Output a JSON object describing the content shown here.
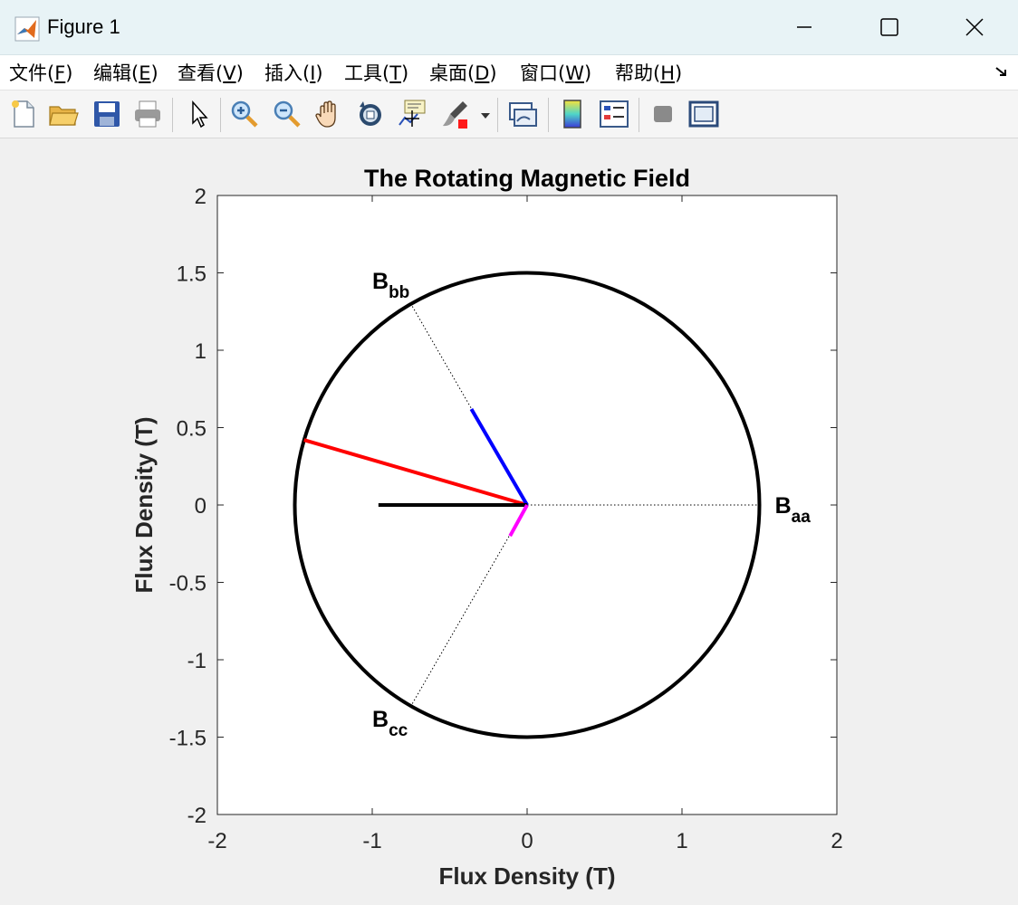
{
  "window": {
    "title": "Figure 1"
  },
  "menu": [
    {
      "label": "文件(",
      "key": "F",
      "tail": ")"
    },
    {
      "label": "编辑(",
      "key": "E",
      "tail": ")"
    },
    {
      "label": "查看(",
      "key": "V",
      "tail": ")"
    },
    {
      "label": "插入(",
      "key": "I",
      "tail": ")"
    },
    {
      "label": "工具(",
      "key": "T",
      "tail": ")"
    },
    {
      "label": "桌面(",
      "key": "D",
      "tail": ")"
    },
    {
      "label": "窗口(",
      "key": "W",
      "tail": ")"
    },
    {
      "label": "帮助(",
      "key": "H",
      "tail": ")"
    }
  ],
  "toolbar_icons": [
    "new-file-icon",
    "open-folder-icon",
    "save-icon",
    "print-icon",
    "pointer-icon",
    "zoom-in-icon",
    "zoom-out-icon",
    "pan-hand-icon",
    "rotate-3d-icon",
    "data-cursor-icon",
    "brush-icon",
    "brush-dropdown-icon",
    "link-plot-icon",
    "colorbar-icon",
    "legend-icon",
    "hide-plot-tools-icon",
    "show-plot-tools-icon"
  ],
  "chart_data": {
    "type": "line",
    "title": "The Rotating Magnetic Field",
    "xlabel": "Flux Density (T)",
    "ylabel": "Flux Density (T)",
    "xlim": [
      -2,
      2
    ],
    "ylim": [
      -2,
      2
    ],
    "xticks": [
      -2,
      -1,
      0,
      1,
      2
    ],
    "yticks": [
      -2,
      -1.5,
      -1,
      -0.5,
      0,
      0.5,
      1,
      1.5,
      2
    ],
    "xtick_labels": [
      "-2",
      "-1",
      "0",
      "1",
      "2"
    ],
    "ytick_labels": [
      "2",
      "1.5",
      "1",
      "0.5",
      "0",
      "-0.5",
      "-1",
      "-1.5",
      "-2"
    ],
    "grid": false,
    "circle": {
      "radius": 1.5,
      "color": "#000000"
    },
    "axis_lines": [
      {
        "name": "aa-axis",
        "x": [
          0,
          1.5
        ],
        "y": [
          0,
          0
        ]
      },
      {
        "name": "bb-axis",
        "x": [
          0,
          -0.75
        ],
        "y": [
          0,
          1.299
        ]
      },
      {
        "name": "cc-axis",
        "x": [
          0,
          -0.75
        ],
        "y": [
          0,
          -1.299
        ]
      }
    ],
    "vectors": [
      {
        "name": "red-vector",
        "color": "#ff0000",
        "x": [
          0,
          -1.44
        ],
        "y": [
          0,
          0.42
        ]
      },
      {
        "name": "blue-vector",
        "color": "#0000ff",
        "x": [
          0,
          -0.36
        ],
        "y": [
          0,
          0.62
        ]
      },
      {
        "name": "black-vector",
        "color": "#000000",
        "x": [
          0,
          -0.96
        ],
        "y": [
          0,
          0
        ]
      },
      {
        "name": "magenta-vector",
        "color": "#ff00ff",
        "x": [
          0,
          -0.11
        ],
        "y": [
          0,
          -0.2
        ]
      }
    ],
    "annotations": [
      {
        "main": "B",
        "sub": "aa",
        "x": 1.6,
        "y": 0.0
      },
      {
        "main": "B",
        "sub": "bb",
        "x": -1.0,
        "y": 1.45
      },
      {
        "main": "B",
        "sub": "cc",
        "x": -1.0,
        "y": -1.38
      }
    ]
  }
}
